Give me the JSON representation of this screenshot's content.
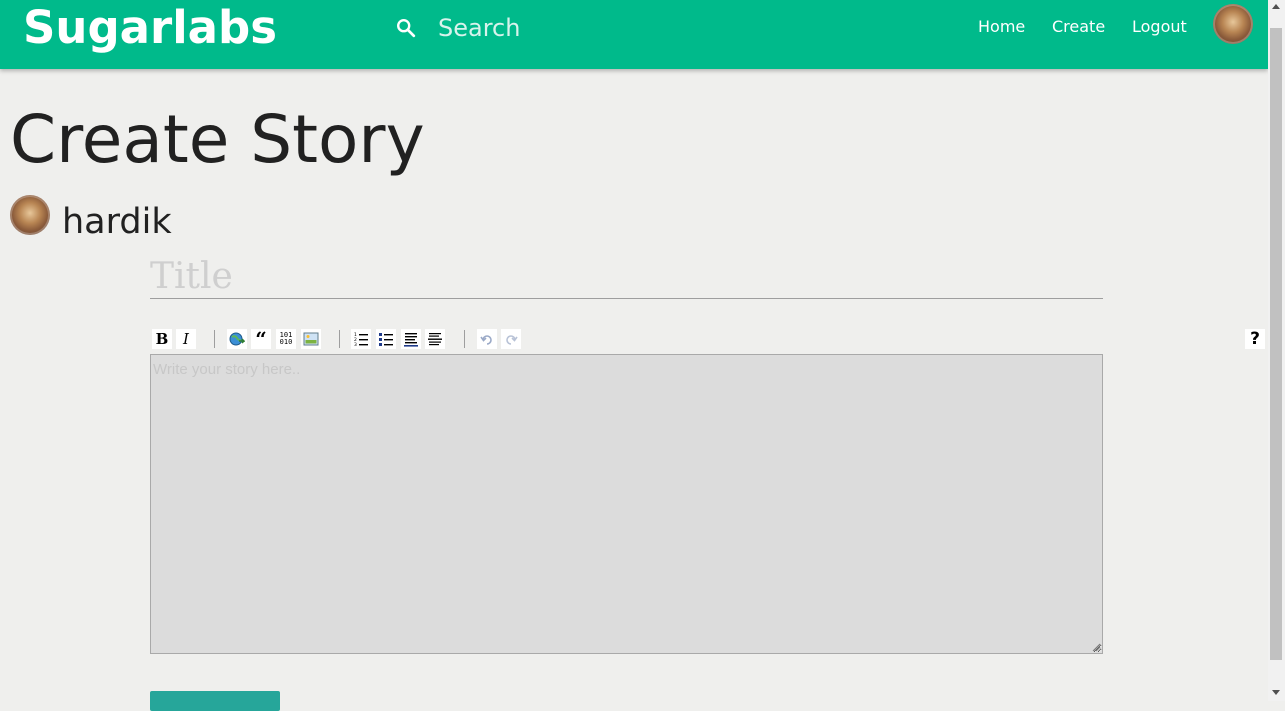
{
  "navbar": {
    "brand": "Sugarlabs",
    "search_placeholder": "Search",
    "links": [
      "Home",
      "Create",
      "Logout"
    ],
    "color": "#00ba8b"
  },
  "page": {
    "title": "Create Story",
    "author": "hardik"
  },
  "form": {
    "title_placeholder": "Title",
    "editor_placeholder": "Write your story here..",
    "toolbar": {
      "bold_label": "B",
      "italic_label": "I",
      "quote_label": "“",
      "code_label": "101\n010",
      "help_label": "?",
      "buttons": [
        "bold-icon",
        "italic-icon",
        "link-icon",
        "quote-icon",
        "code-icon",
        "image-icon",
        "ordered-list-icon",
        "unordered-list-icon",
        "heading-icon",
        "horizontal-rule-icon",
        "undo-icon",
        "redo-icon",
        "help-icon"
      ]
    },
    "submit_color": "#26a69a"
  }
}
